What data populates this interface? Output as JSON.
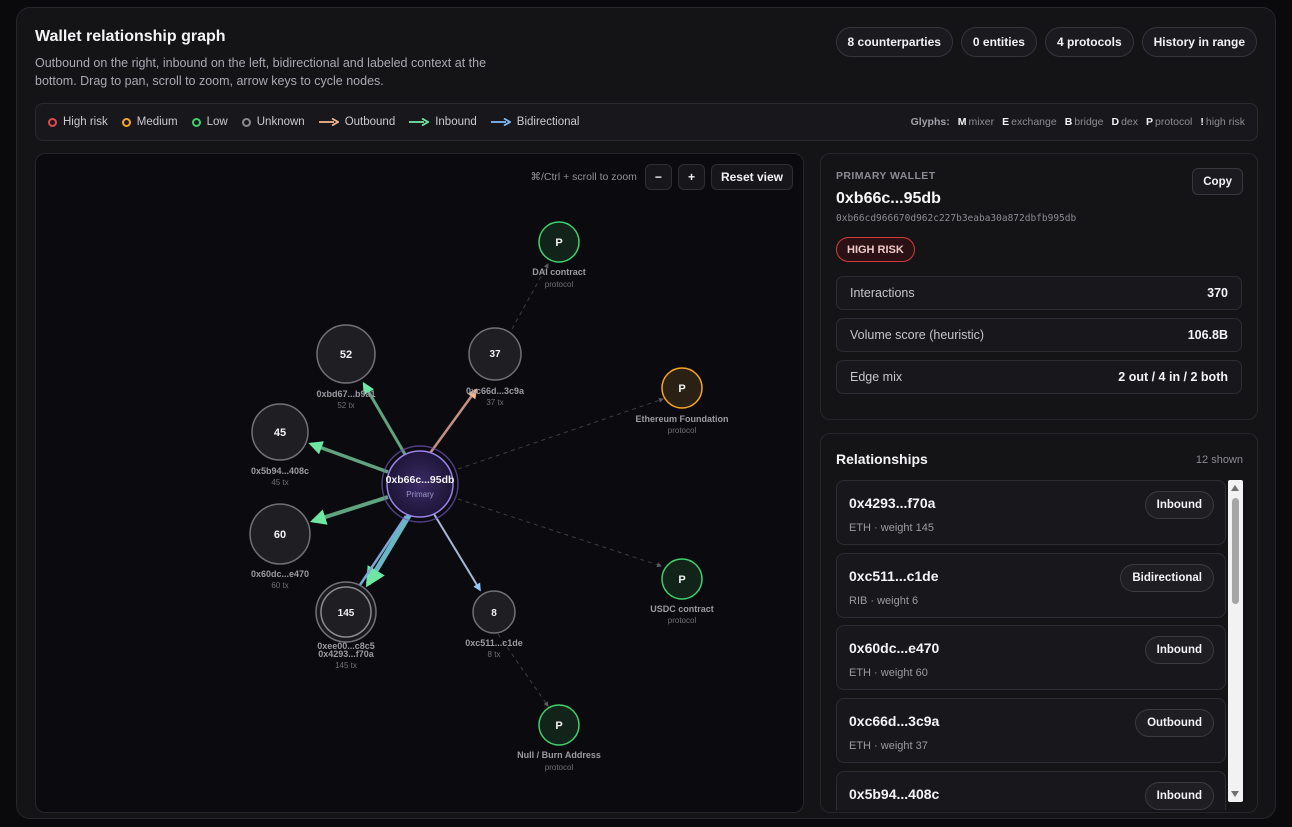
{
  "header": {
    "title": "Wallet relationship graph",
    "subtitle": "Outbound on the right, inbound on the left, bidirectional and labeled context at the bottom. Drag to pan, scroll to zoom, arrow keys to cycle nodes.",
    "pills": [
      "8 counterparties",
      "0 entities",
      "4 protocols",
      "History in range"
    ]
  },
  "legend": {
    "items": [
      {
        "label": "High risk",
        "kind": "ring",
        "color": "#e5484d"
      },
      {
        "label": "Medium",
        "kind": "ring",
        "color": "#f5a524"
      },
      {
        "label": "Low",
        "kind": "ring",
        "color": "#3fcf6b"
      },
      {
        "label": "Unknown",
        "kind": "ring",
        "color": "#8a8a92"
      },
      {
        "label": "Outbound",
        "kind": "arrow",
        "color": "#f0b48e"
      },
      {
        "label": "Inbound",
        "kind": "arrow",
        "color": "#6ee7a2"
      },
      {
        "label": "Bidirectional",
        "kind": "arrow",
        "color": "#7cb8f5"
      }
    ],
    "glyphs_title": "Glyphs:",
    "glyphs": [
      {
        "key": "M",
        "label": "mixer"
      },
      {
        "key": "E",
        "label": "exchange"
      },
      {
        "key": "B",
        "label": "bridge"
      },
      {
        "key": "D",
        "label": "dex"
      },
      {
        "key": "P",
        "label": "protocol"
      },
      {
        "key": "!",
        "label": "high risk"
      }
    ]
  },
  "graph": {
    "zoom_hint": "⌘/Ctrl + scroll to zoom",
    "zoom_out": "−",
    "zoom_in": "+",
    "reset": "Reset view",
    "center": {
      "label": "0xb66c...95db",
      "sub": "Primary"
    },
    "nodes": [
      {
        "id": "bd67",
        "glyph": "52",
        "label": "0xbd67...b9a1",
        "sub": "52 tx",
        "kind": "wallet"
      },
      {
        "id": "c66d",
        "glyph": "37",
        "label": "0xc66d...3c9a",
        "sub": "37 tx",
        "kind": "wallet"
      },
      {
        "id": "5b94",
        "glyph": "45",
        "label": "0x5b94...408c",
        "sub": "45 tx",
        "kind": "wallet"
      },
      {
        "id": "60dc",
        "glyph": "60",
        "label": "0x60dc...e470",
        "sub": "60 tx",
        "kind": "wallet"
      },
      {
        "id": "4293",
        "glyph": "145",
        "label": "0x4293...f70a",
        "sub": "145 tx",
        "kind": "wallet"
      },
      {
        "id": "ee00",
        "glyph": "",
        "label": "0xee00...c8c5",
        "sub": "",
        "kind": "wallet"
      },
      {
        "id": "c511",
        "glyph": "8",
        "label": "0xc511...c1de",
        "sub": "8 tx",
        "kind": "wallet"
      },
      {
        "id": "dai",
        "glyph": "P",
        "label": "DAI contract",
        "sub": "protocol",
        "kind": "protocol-low"
      },
      {
        "id": "eth",
        "glyph": "P",
        "label": "Ethereum Foundation",
        "sub": "protocol",
        "kind": "protocol-med"
      },
      {
        "id": "usdc",
        "glyph": "P",
        "label": "USDC contract",
        "sub": "protocol",
        "kind": "protocol-low"
      },
      {
        "id": "null",
        "glyph": "P",
        "label": "Null / Burn Address",
        "sub": "protocol",
        "kind": "protocol-low"
      }
    ],
    "edges": [
      {
        "to": "bd67",
        "dir": "inbound"
      },
      {
        "to": "5b94",
        "dir": "inbound"
      },
      {
        "to": "60dc",
        "dir": "inbound"
      },
      {
        "to": "4293",
        "dir": "inbound"
      },
      {
        "to": "ee00",
        "dir": "bidirectional"
      },
      {
        "to": "c66d",
        "dir": "outbound"
      },
      {
        "to": "c511",
        "dir": "bidirectional"
      }
    ],
    "dashed": [
      {
        "from": "c66d",
        "to": "dai"
      },
      {
        "from": "center",
        "to": "eth"
      },
      {
        "from": "center",
        "to": "usdc"
      },
      {
        "from": "c511",
        "to": "null"
      }
    ]
  },
  "primary": {
    "label": "PRIMARY WALLET",
    "short": "0xb66c...95db",
    "full": "0xb66cd966670d962c227b3eaba30a872dbfb995db",
    "copy": "Copy",
    "risk": "HIGH RISK",
    "stats": [
      {
        "label": "Interactions",
        "value": "370"
      },
      {
        "label": "Volume score (heuristic)",
        "value": "106.8B"
      },
      {
        "label": "Edge mix",
        "value": "2 out / 4 in / 2 both"
      }
    ]
  },
  "relationships": {
    "title": "Relationships",
    "count": "12 shown",
    "items": [
      {
        "addr": "0x4293...f70a",
        "meta": "ETH · weight 145",
        "tag": "Inbound"
      },
      {
        "addr": "0xc511...c1de",
        "meta": "RIB · weight 6",
        "tag": "Bidirectional"
      },
      {
        "addr": "0x60dc...e470",
        "meta": "ETH · weight 60",
        "tag": "Inbound"
      },
      {
        "addr": "0xc66d...3c9a",
        "meta": "ETH · weight 37",
        "tag": "Outbound"
      },
      {
        "addr": "0x5b94...408c",
        "meta": "",
        "tag": "Inbound"
      }
    ]
  }
}
